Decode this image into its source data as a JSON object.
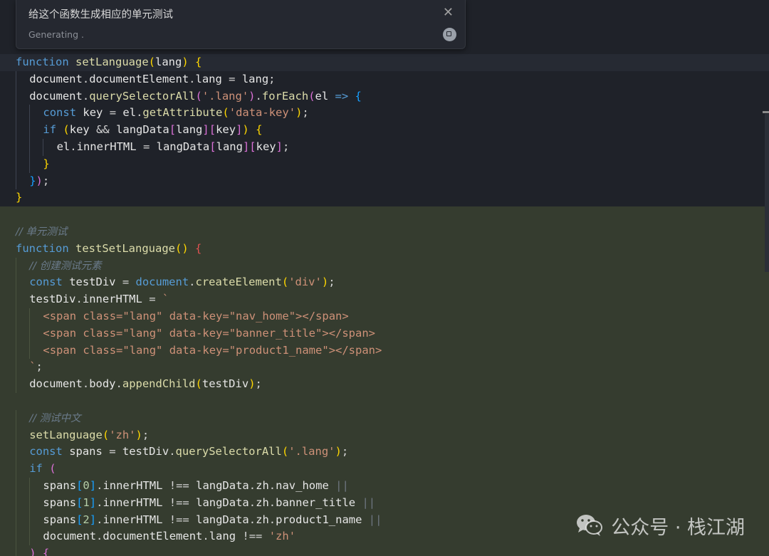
{
  "popup": {
    "prompt": "给这个函数生成相应的单元测试",
    "status": "Generating .",
    "close_glyph": "✕",
    "stop_icon": "stop-icon"
  },
  "watermark": {
    "text": "公众号 · 栈江湖",
    "icon": "wechat-icon"
  },
  "colors": {
    "editor_bg": "#1f2229",
    "added_bg": "#353c2f",
    "keyword": "#569cd6",
    "function": "#dcdcaa",
    "string": "#ce9178",
    "comment": "#6a7a8a"
  },
  "editor": {
    "lines": [
      {
        "indent": 0,
        "bg": "hl",
        "tokens": [
          [
            "function ",
            "kw"
          ],
          [
            "setLanguage",
            "fn"
          ],
          [
            "(",
            "b1"
          ],
          [
            "lang",
            "id"
          ],
          [
            ")",
            "b1"
          ],
          [
            " ",
            "pu"
          ],
          [
            "{",
            "b1"
          ]
        ]
      },
      {
        "indent": 1,
        "bg": "",
        "tokens": [
          [
            "document",
            "id"
          ],
          [
            ".",
            "pu"
          ],
          [
            "documentElement",
            "id"
          ],
          [
            ".",
            "pu"
          ],
          [
            "lang",
            "id"
          ],
          [
            " = ",
            "op"
          ],
          [
            "lang",
            "id"
          ],
          [
            ";",
            "pu"
          ]
        ]
      },
      {
        "indent": 1,
        "bg": "",
        "tokens": [
          [
            "document",
            "id"
          ],
          [
            ".",
            "pu"
          ],
          [
            "querySelectorAll",
            "fn"
          ],
          [
            "(",
            "b2"
          ],
          [
            "'.lang'",
            "str"
          ],
          [
            ")",
            "b2"
          ],
          [
            ".",
            "pu"
          ],
          [
            "forEach",
            "fn"
          ],
          [
            "(",
            "b2"
          ],
          [
            "el",
            "id"
          ],
          [
            " => ",
            "kw"
          ],
          [
            "{",
            "b3"
          ]
        ]
      },
      {
        "indent": 2,
        "bg": "",
        "tokens": [
          [
            "const ",
            "kw"
          ],
          [
            "key",
            "id"
          ],
          [
            " = ",
            "op"
          ],
          [
            "el",
            "id"
          ],
          [
            ".",
            "pu"
          ],
          [
            "getAttribute",
            "fn"
          ],
          [
            "(",
            "b1"
          ],
          [
            "'data-key'",
            "str"
          ],
          [
            ")",
            "b1"
          ],
          [
            ";",
            "pu"
          ]
        ]
      },
      {
        "indent": 2,
        "bg": "",
        "tokens": [
          [
            "if ",
            "kw"
          ],
          [
            "(",
            "b1"
          ],
          [
            "key",
            "id"
          ],
          [
            " && ",
            "op"
          ],
          [
            "langData",
            "id"
          ],
          [
            "[",
            "b2"
          ],
          [
            "lang",
            "id"
          ],
          [
            "]",
            "b2"
          ],
          [
            "[",
            "b2"
          ],
          [
            "key",
            "id"
          ],
          [
            "]",
            "b2"
          ],
          [
            ")",
            "b1"
          ],
          [
            " ",
            "pu"
          ],
          [
            "{",
            "b1"
          ]
        ]
      },
      {
        "indent": 3,
        "bg": "",
        "tokens": [
          [
            "el",
            "id"
          ],
          [
            ".",
            "pu"
          ],
          [
            "innerHTML",
            "id"
          ],
          [
            " = ",
            "op"
          ],
          [
            "langData",
            "id"
          ],
          [
            "[",
            "b2"
          ],
          [
            "lang",
            "id"
          ],
          [
            "]",
            "b2"
          ],
          [
            "[",
            "b2"
          ],
          [
            "key",
            "id"
          ],
          [
            "]",
            "b2"
          ],
          [
            ";",
            "pu"
          ]
        ]
      },
      {
        "indent": 2,
        "bg": "",
        "tokens": [
          [
            "}",
            "b1"
          ]
        ]
      },
      {
        "indent": 1,
        "bg": "",
        "tokens": [
          [
            "}",
            "b3"
          ],
          [
            ")",
            "b2"
          ],
          [
            ";",
            "pu"
          ]
        ]
      },
      {
        "indent": 0,
        "bg": "",
        "tokens": [
          [
            "}",
            "b1"
          ]
        ]
      },
      {
        "indent": 0,
        "bg": "added",
        "tokens": []
      },
      {
        "indent": 0,
        "bg": "added",
        "tokens": [
          [
            "// 单元测试",
            "cmt"
          ]
        ]
      },
      {
        "indent": 0,
        "bg": "added",
        "tokens": [
          [
            "function ",
            "kw"
          ],
          [
            "testSetLanguage",
            "fn"
          ],
          [
            "() ",
            "b1"
          ],
          [
            "{",
            "br"
          ]
        ]
      },
      {
        "indent": 1,
        "bg": "added",
        "tokens": [
          [
            "// 创建测试元素",
            "cmt"
          ]
        ]
      },
      {
        "indent": 1,
        "bg": "added",
        "tokens": [
          [
            "const ",
            "kw"
          ],
          [
            "testDiv",
            "id"
          ],
          [
            " = ",
            "op"
          ],
          [
            "document",
            "kw"
          ],
          [
            ".",
            "pu"
          ],
          [
            "createElement",
            "fn"
          ],
          [
            "(",
            "b1"
          ],
          [
            "'div'",
            "str"
          ],
          [
            ")",
            "b1"
          ],
          [
            ";",
            "pu"
          ]
        ]
      },
      {
        "indent": 1,
        "bg": "added",
        "tokens": [
          [
            "testDiv",
            "id"
          ],
          [
            ".",
            "pu"
          ],
          [
            "innerHTML",
            "id"
          ],
          [
            " = ",
            "op"
          ],
          [
            "`",
            "str"
          ]
        ]
      },
      {
        "indent": 2,
        "bg": "added",
        "tokens": [
          [
            "<span ",
            "str"
          ],
          [
            "class=\"lang\" ",
            "str"
          ],
          [
            "data-key=\"nav_home\"",
            "str"
          ],
          [
            "></span>",
            "str"
          ]
        ]
      },
      {
        "indent": 2,
        "bg": "added",
        "tokens": [
          [
            "<span ",
            "str"
          ],
          [
            "class=\"lang\" ",
            "str"
          ],
          [
            "data-key=\"banner_title\"",
            "str"
          ],
          [
            "></span>",
            "str"
          ]
        ]
      },
      {
        "indent": 2,
        "bg": "added",
        "tokens": [
          [
            "<span ",
            "str"
          ],
          [
            "class=\"lang\" ",
            "str"
          ],
          [
            "data-key=\"product1_name\"",
            "str"
          ],
          [
            "></span>",
            "str"
          ]
        ]
      },
      {
        "indent": 1,
        "bg": "added",
        "tokens": [
          [
            "`",
            "str"
          ],
          [
            ";",
            "pu"
          ]
        ]
      },
      {
        "indent": 1,
        "bg": "added",
        "tokens": [
          [
            "document",
            "id"
          ],
          [
            ".",
            "pu"
          ],
          [
            "body",
            "id"
          ],
          [
            ".",
            "pu"
          ],
          [
            "appendChild",
            "fn"
          ],
          [
            "(",
            "b1"
          ],
          [
            "testDiv",
            "id"
          ],
          [
            ")",
            "b1"
          ],
          [
            ";",
            "pu"
          ]
        ]
      },
      {
        "indent": 0,
        "bg": "added",
        "tokens": []
      },
      {
        "indent": 1,
        "bg": "added",
        "tokens": [
          [
            "// 测试中文",
            "cmt"
          ]
        ]
      },
      {
        "indent": 1,
        "bg": "added",
        "tokens": [
          [
            "setLanguage",
            "fn"
          ],
          [
            "(",
            "b1"
          ],
          [
            "'zh'",
            "str"
          ],
          [
            ")",
            "b1"
          ],
          [
            ";",
            "pu"
          ]
        ]
      },
      {
        "indent": 1,
        "bg": "added",
        "tokens": [
          [
            "const ",
            "kw"
          ],
          [
            "spans",
            "id"
          ],
          [
            " = ",
            "op"
          ],
          [
            "testDiv",
            "id"
          ],
          [
            ".",
            "pu"
          ],
          [
            "querySelectorAll",
            "fn"
          ],
          [
            "(",
            "b1"
          ],
          [
            "'.lang'",
            "str"
          ],
          [
            ")",
            "b1"
          ],
          [
            ";",
            "pu"
          ]
        ]
      },
      {
        "indent": 1,
        "bg": "added",
        "tokens": [
          [
            "if ",
            "kw"
          ],
          [
            "(",
            "b2"
          ]
        ]
      },
      {
        "indent": 2,
        "bg": "added",
        "tokens": [
          [
            "spans",
            "id"
          ],
          [
            "[",
            "b3"
          ],
          [
            "0",
            "num"
          ],
          [
            "]",
            "b3"
          ],
          [
            ".",
            "pu"
          ],
          [
            "innerHTML",
            "id"
          ],
          [
            " !== ",
            "op"
          ],
          [
            "langData",
            "id"
          ],
          [
            ".",
            "pu"
          ],
          [
            "zh",
            "id"
          ],
          [
            ".",
            "pu"
          ],
          [
            "nav_home",
            "id"
          ],
          [
            " ||",
            "pipe"
          ]
        ]
      },
      {
        "indent": 2,
        "bg": "added",
        "tokens": [
          [
            "spans",
            "id"
          ],
          [
            "[",
            "b3"
          ],
          [
            "1",
            "num"
          ],
          [
            "]",
            "b3"
          ],
          [
            ".",
            "pu"
          ],
          [
            "innerHTML",
            "id"
          ],
          [
            " !== ",
            "op"
          ],
          [
            "langData",
            "id"
          ],
          [
            ".",
            "pu"
          ],
          [
            "zh",
            "id"
          ],
          [
            ".",
            "pu"
          ],
          [
            "banner_title",
            "id"
          ],
          [
            " ||",
            "pipe"
          ]
        ]
      },
      {
        "indent": 2,
        "bg": "added",
        "tokens": [
          [
            "spans",
            "id"
          ],
          [
            "[",
            "b3"
          ],
          [
            "2",
            "num"
          ],
          [
            "]",
            "b3"
          ],
          [
            ".",
            "pu"
          ],
          [
            "innerHTML",
            "id"
          ],
          [
            " !== ",
            "op"
          ],
          [
            "langData",
            "id"
          ],
          [
            ".",
            "pu"
          ],
          [
            "zh",
            "id"
          ],
          [
            ".",
            "pu"
          ],
          [
            "product1_name",
            "id"
          ],
          [
            " ||",
            "pipe"
          ]
        ]
      },
      {
        "indent": 2,
        "bg": "added",
        "tokens": [
          [
            "document",
            "id"
          ],
          [
            ".",
            "pu"
          ],
          [
            "documentElement",
            "id"
          ],
          [
            ".",
            "pu"
          ],
          [
            "lang",
            "id"
          ],
          [
            " !== ",
            "op"
          ],
          [
            "'zh'",
            "str"
          ]
        ]
      },
      {
        "indent": 1,
        "bg": "added",
        "tokens": [
          [
            ") ",
            "b2"
          ],
          [
            "{",
            "b2"
          ]
        ]
      }
    ]
  }
}
